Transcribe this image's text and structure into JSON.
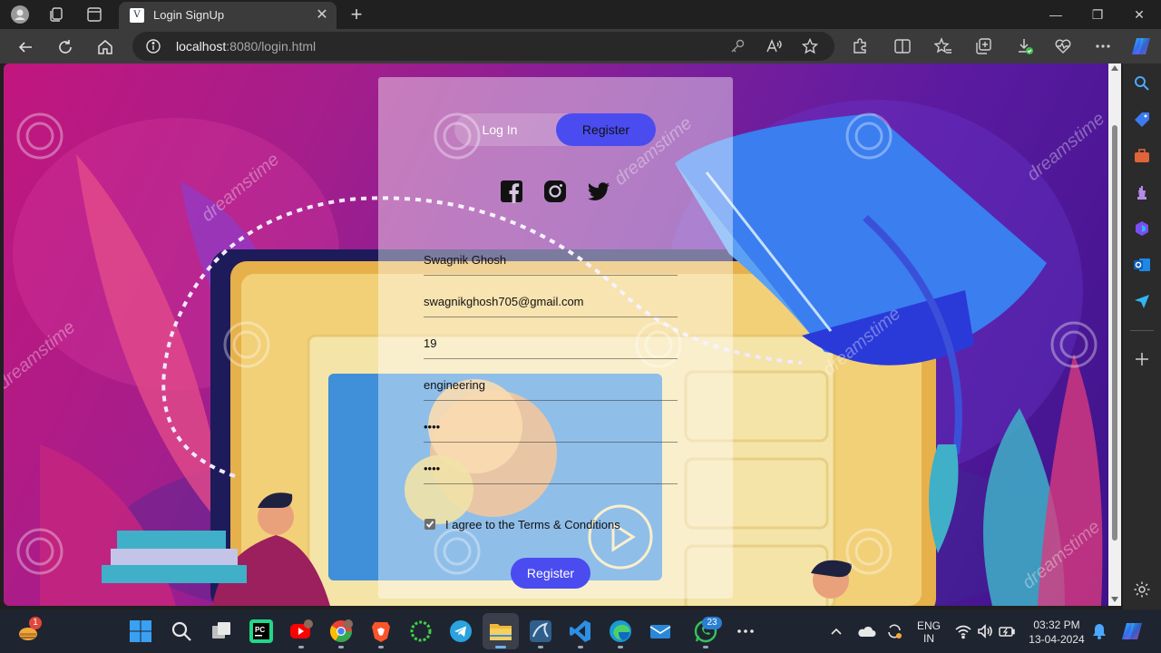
{
  "browser": {
    "tab_title": "Login SignUp",
    "tab_favicon_letter": "V",
    "url_host": "localhost",
    "url_rest": ":8080/login.html"
  },
  "form": {
    "tab_login_label": "Log In",
    "tab_register_label": "Register",
    "fields": {
      "name": "Swagnik Ghosh",
      "email": "swagnikghosh705@gmail.com",
      "age": "19",
      "course": "engineering",
      "password": "••••",
      "confirm_password": "••••"
    },
    "terms_label": "I agree to the Terms & Conditions",
    "terms_checked": true,
    "submit_label": "Register",
    "accent_color": "#4a4cf0"
  },
  "background": {
    "watermark_text": "dreamstime"
  },
  "taskbar": {
    "weather_badge": "1",
    "whatsapp_badge": "23",
    "lang_line1": "ENG",
    "lang_line2": "IN",
    "time": "03:32 PM",
    "date": "13-04-2024"
  }
}
